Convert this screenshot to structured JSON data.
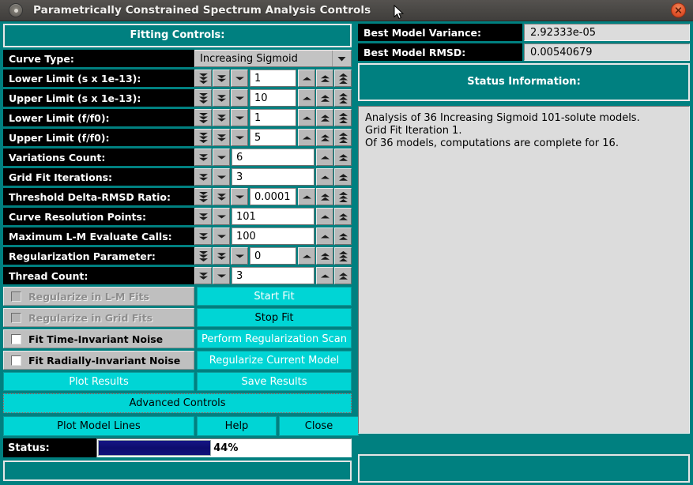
{
  "window": {
    "title": "Parametrically Constrained Spectrum Analysis Controls",
    "icon": "window-menu-icon",
    "close_icon": "close-icon"
  },
  "left": {
    "banner": "Fitting Controls:",
    "curve_type": {
      "label": "Curve Type:",
      "value": "Increasing Sigmoid",
      "arrow_icon": "chevron-down-icon"
    },
    "fields": [
      {
        "label": "Lower Limit (s x 1e-13):",
        "value": "1",
        "spinners": 3
      },
      {
        "label": "Upper Limit (s x 1e-13):",
        "value": "10",
        "spinners": 3
      },
      {
        "label": "Lower Limit (f/f0):",
        "value": "1",
        "spinners": 3
      },
      {
        "label": "Upper Limit (f/f0):",
        "value": "5",
        "spinners": 3
      },
      {
        "label": "Variations Count:",
        "value": "6",
        "spinners": 2
      },
      {
        "label": "Grid Fit Iterations:",
        "value": "3",
        "spinners": 2
      },
      {
        "label": "Threshold Delta-RMSD Ratio:",
        "value": "0.0001",
        "spinners": 3
      },
      {
        "label": "Curve Resolution Points:",
        "value": "101",
        "spinners": 2
      },
      {
        "label": "Maximum L-M Evaluate Calls:",
        "value": "100",
        "spinners": 2
      },
      {
        "label": "Regularization Parameter:",
        "value": "0",
        "spinners": 3
      },
      {
        "label": "Thread Count:",
        "value": "3",
        "spinners": 2
      }
    ],
    "checkboxes": [
      {
        "label": "Regularize in L-M Fits",
        "checked": false,
        "enabled": false
      },
      {
        "label": "Regularize in Grid Fits",
        "checked": false,
        "enabled": false
      },
      {
        "label": "Fit Time-Invariant Noise",
        "checked": false,
        "enabled": true
      },
      {
        "label": "Fit Radially-Invariant Noise",
        "checked": false,
        "enabled": true
      }
    ],
    "right_buttons": [
      {
        "label": "Start Fit",
        "white": true
      },
      {
        "label": "Stop Fit",
        "white": false
      },
      {
        "label": "Perform Regularization Scan",
        "white": true
      },
      {
        "label": "Regularize Current Model",
        "white": true
      },
      {
        "label": "Save Results",
        "white": true
      }
    ],
    "plot_results": "Plot Results",
    "advanced_controls": "Advanced Controls",
    "bottom_buttons": [
      {
        "label": "Plot Model Lines",
        "white": false
      },
      {
        "label": "Help",
        "white": false
      },
      {
        "label": "Close",
        "white": false
      }
    ],
    "status": {
      "label": "Status:",
      "percent_text": "44%",
      "percent_value": 44
    }
  },
  "right": {
    "variance": {
      "label": "Best Model Variance:",
      "value": "2.92333e-05"
    },
    "rmsd": {
      "label": "Best Model RMSD:",
      "value": "0.00540679"
    },
    "status_banner": "Status Information:",
    "status_text": "Analysis of 36 Increasing Sigmoid 101-solute models.\nGrid Fit Iteration 1.\nOf 36 models, computations are complete for 16."
  },
  "colors": {
    "teal": "#008080",
    "cyan_button": "#00d5d5",
    "label_bg": "#000000",
    "progress_fill": "#101080"
  }
}
